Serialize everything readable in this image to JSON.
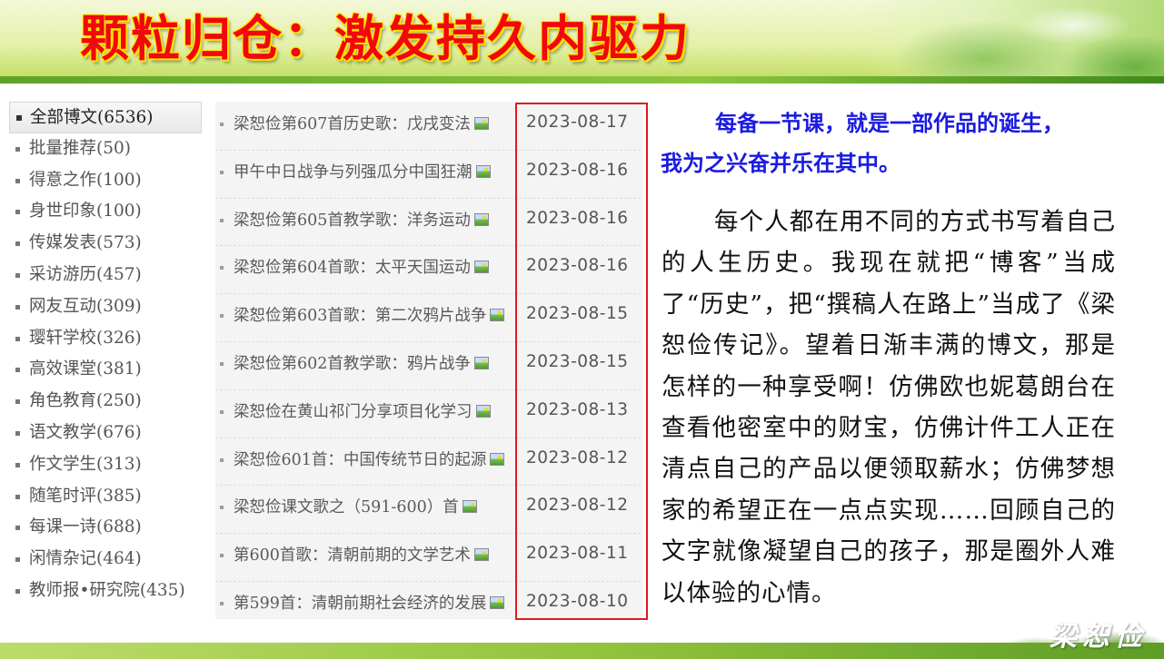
{
  "slide": {
    "title": "颗粒归仓：激发持久内驱力",
    "signature": "梁恕俭"
  },
  "categories": [
    {
      "label": "全部博文(6536)",
      "active": true
    },
    {
      "label": "批量推荐(50)"
    },
    {
      "label": "得意之作(100)"
    },
    {
      "label": "身世印象(100)"
    },
    {
      "label": "传媒发表(573)"
    },
    {
      "label": "采访游历(457)"
    },
    {
      "label": "网友互动(309)"
    },
    {
      "label": "璎轩学校(326)"
    },
    {
      "label": "高效课堂(381)"
    },
    {
      "label": "角色教育(250)"
    },
    {
      "label": "语文教学(676)"
    },
    {
      "label": "作文学生(313)"
    },
    {
      "label": "随笔时评(385)"
    },
    {
      "label": "每课一诗(688)"
    },
    {
      "label": "闲情杂记(464)"
    },
    {
      "label": "教师报•研究院(435)"
    }
  ],
  "articles": [
    {
      "title": "梁恕俭第607首历史歌：戊戌变法",
      "date": "2023-08-17"
    },
    {
      "title": "甲午中日战争与列强瓜分中国狂潮",
      "date": "2023-08-16"
    },
    {
      "title": "梁恕俭第605首教学歌：洋务运动",
      "date": "2023-08-16"
    },
    {
      "title": "梁恕俭第604首歌：太平天国运动",
      "date": "2023-08-16"
    },
    {
      "title": "梁恕俭第603首歌：第二次鸦片战争",
      "date": "2023-08-15"
    },
    {
      "title": "梁恕俭第602首教学歌：鸦片战争",
      "date": "2023-08-15"
    },
    {
      "title": "梁恕俭在黄山祁门分享项目化学习",
      "date": "2023-08-13"
    },
    {
      "title": "梁恕俭601首：中国传统节日的起源",
      "date": "2023-08-12"
    },
    {
      "title": "梁恕俭课文歌之（591-600）首",
      "date": "2023-08-12"
    },
    {
      "title": "第600首歌：清朝前期的文学艺术",
      "date": "2023-08-11"
    },
    {
      "title": "第599首：清朝前期社会经济的发展",
      "date": "2023-08-10"
    }
  ],
  "quote": {
    "line1": "每备一节课，就是一部作品的诞生，",
    "line2": "我为之兴奋并乐在其中。"
  },
  "body_text": "每个人都在用不同的方式书写着自己的人生历史。我现在就把“博客”当成了“历史”，把“撰稿人在路上”当成了《梁恕俭传记》。望着日渐丰满的博文，那是怎样的一种享受啊！仿佛欧也妮葛朗台在查看他密室中的财宝，仿佛计件工人正在清点自己的产品以便领取薪水；仿佛梦想家的希望正在一点点实现……回顾自己的文字就像凝望自己的孩子，那是圈外人难以体验的心情。",
  "colors": {
    "title": "#f2070c",
    "title_outline": "#ffe600",
    "quote": "#1a1ae0",
    "highlight_box": "#e0191e",
    "accent_green": "#8cc63f"
  }
}
